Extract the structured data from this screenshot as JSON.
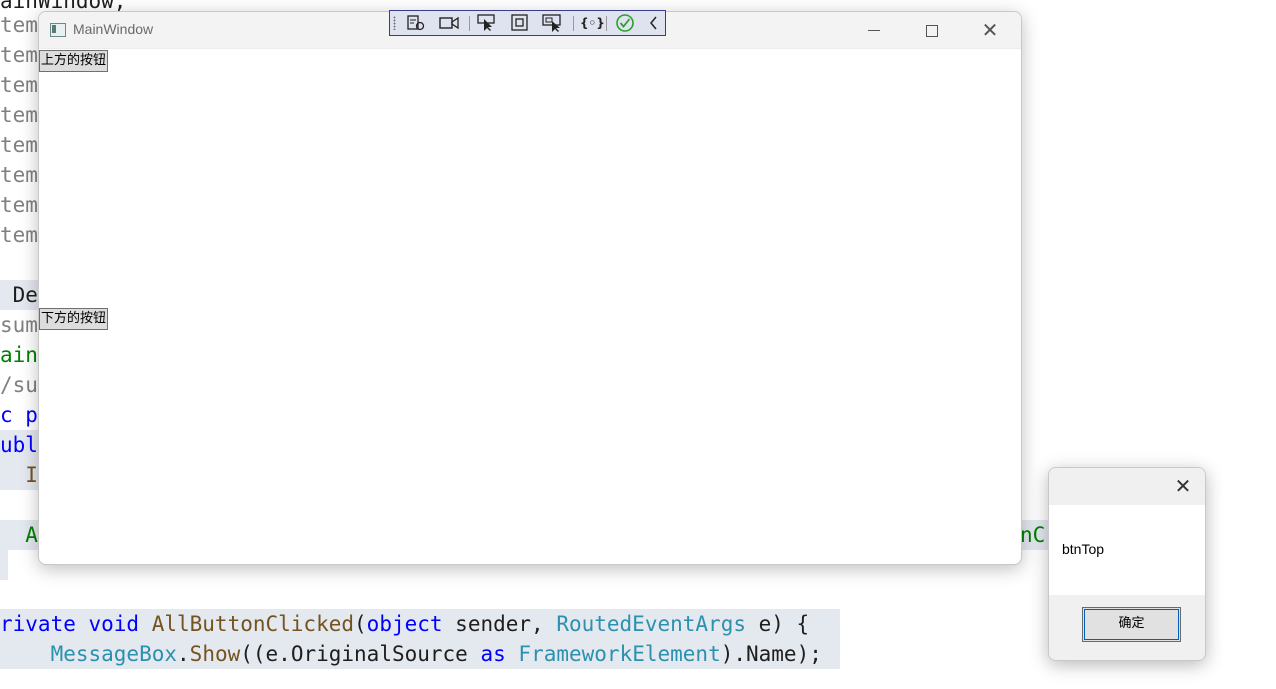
{
  "editor": {
    "line0": "ainWindow;",
    "item_lines": [
      "tem.",
      "tem.",
      "tem.",
      "tem.",
      "tem.",
      "tem.",
      "tem.",
      "tem."
    ],
    "line_der": " Der",
    "line_summ1": "summ",
    "line_mainw": "ainW",
    "line_summ2": "/sum",
    "line_cpa": "c pa",
    "line_publi": "ubli",
    "line_i": "  I",
    "line_a": "  A",
    "line_nc": "nC",
    "method_line": {
      "kw": "rivate void ",
      "name": "AllButtonClicked",
      "p1": "(",
      "t1": "object",
      "p2": " sender, ",
      "t2": "RoutedEventArgs",
      "p3": " e) {"
    },
    "call_line": {
      "indent": "    ",
      "cls": "MessageBox",
      "p1": ".",
      "method": "Show",
      "p2": "((e.OriginalSource ",
      "kw": "as",
      "p3": " ",
      "type": "FrameworkElement",
      "p4": ").Name);"
    }
  },
  "main_window": {
    "title": "MainWindow",
    "top_button": "上方的按钮",
    "bottom_button": "下方的按钮"
  },
  "debug_toolbar": {
    "icons": [
      "select-element-icon",
      "video-camera-icon",
      "pointer-select-icon",
      "display-layout-adorners-icon",
      "track-focus-icon",
      "binding-failures-icon",
      "check-icon",
      "collapse-chevron-icon"
    ]
  },
  "message_box": {
    "text": "btnTop",
    "ok_label": "确定"
  }
}
